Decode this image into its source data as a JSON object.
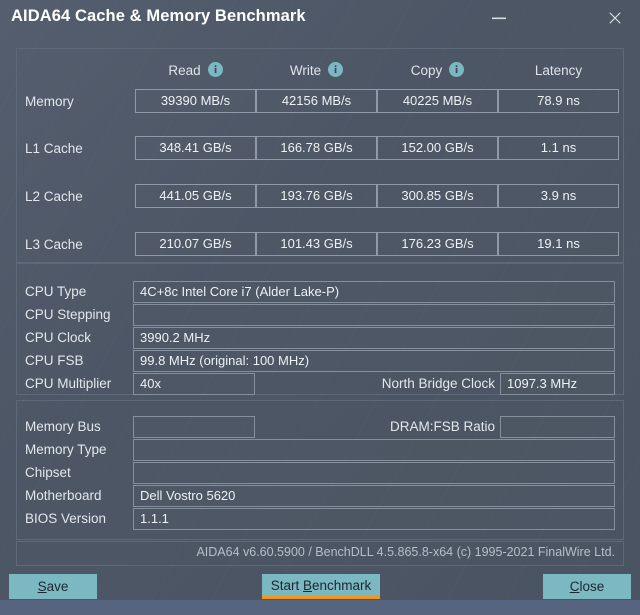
{
  "window": {
    "title": "AIDA64 Cache & Memory Benchmark",
    "minimize_icon": "minimize-icon",
    "close_icon": "close-icon"
  },
  "benchmark": {
    "columns": [
      {
        "label": "Read",
        "info_icon": "info-icon"
      },
      {
        "label": "Write",
        "info_icon": "info-icon"
      },
      {
        "label": "Copy",
        "info_icon": "info-icon"
      },
      {
        "label": "Latency",
        "info_icon": ""
      }
    ],
    "rows": [
      {
        "label": "Memory",
        "read": "39390 MB/s",
        "write": "42156 MB/s",
        "copy": "40225 MB/s",
        "latency": "78.9 ns"
      },
      {
        "label": "L1 Cache",
        "read": "348.41 GB/s",
        "write": "166.78 GB/s",
        "copy": "152.00 GB/s",
        "latency": "1.1 ns"
      },
      {
        "label": "L2 Cache",
        "read": "441.05 GB/s",
        "write": "193.76 GB/s",
        "copy": "300.85 GB/s",
        "latency": "3.9 ns"
      },
      {
        "label": "L3 Cache",
        "read": "210.07 GB/s",
        "write": "101.43 GB/s",
        "copy": "176.23 GB/s",
        "latency": "19.1 ns"
      }
    ]
  },
  "cpu_info": {
    "cpu_type_label": "CPU Type",
    "cpu_type_value": "4C+8c Intel Core i7  (Alder Lake-P)",
    "cpu_stepping_label": "CPU Stepping",
    "cpu_stepping_value": "",
    "cpu_clock_label": "CPU Clock",
    "cpu_clock_value": "3990.2 MHz",
    "cpu_fsb_label": "CPU FSB",
    "cpu_fsb_value": "99.8 MHz  (original: 100 MHz)",
    "cpu_multiplier_label": "CPU Multiplier",
    "cpu_multiplier_value": "40x",
    "north_bridge_label": "North Bridge Clock",
    "north_bridge_value": "1097.3 MHz"
  },
  "memory_info": {
    "memory_bus_label": "Memory Bus",
    "memory_bus_value": "",
    "dram_fsb_label": "DRAM:FSB Ratio",
    "dram_fsb_value": "",
    "memory_type_label": "Memory Type",
    "memory_type_value": "",
    "chipset_label": "Chipset",
    "chipset_value": "",
    "motherboard_label": "Motherboard",
    "motherboard_value": "Dell Vostro 5620",
    "bios_label": "BIOS Version",
    "bios_value": "1.1.1"
  },
  "footer": {
    "version_text": "AIDA64 v6.60.5900 / BenchDLL 4.5.865.8-x64  (c) 1995-2021 FinalWire Ltd."
  },
  "buttons": {
    "save": {
      "pre": "",
      "accel": "S",
      "post": "ave"
    },
    "start": {
      "pre": "Start ",
      "accel": "B",
      "post": "enchmark"
    },
    "close": {
      "pre": "",
      "accel": "C",
      "post": "lose"
    }
  },
  "colors": {
    "window_bg": "#4c5665",
    "accent_teal": "#7bb8c2",
    "focus_orange": "#f0951e",
    "title_text": "#ffffff",
    "box_border": "#9099a8",
    "desk_strip": "#566480"
  }
}
